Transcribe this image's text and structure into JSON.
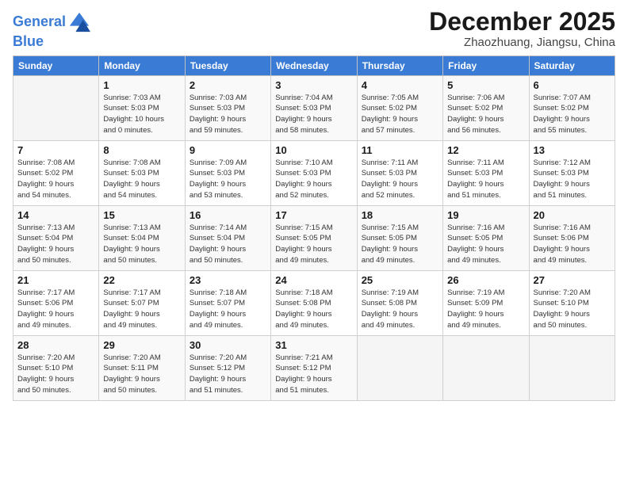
{
  "header": {
    "logo_line1": "General",
    "logo_line2": "Blue",
    "month": "December 2025",
    "location": "Zhaozhuang, Jiangsu, China"
  },
  "weekdays": [
    "Sunday",
    "Monday",
    "Tuesday",
    "Wednesday",
    "Thursday",
    "Friday",
    "Saturday"
  ],
  "weeks": [
    [
      {
        "day": "",
        "info": ""
      },
      {
        "day": "1",
        "info": "Sunrise: 7:03 AM\nSunset: 5:03 PM\nDaylight: 10 hours\nand 0 minutes."
      },
      {
        "day": "2",
        "info": "Sunrise: 7:03 AM\nSunset: 5:03 PM\nDaylight: 9 hours\nand 59 minutes."
      },
      {
        "day": "3",
        "info": "Sunrise: 7:04 AM\nSunset: 5:03 PM\nDaylight: 9 hours\nand 58 minutes."
      },
      {
        "day": "4",
        "info": "Sunrise: 7:05 AM\nSunset: 5:02 PM\nDaylight: 9 hours\nand 57 minutes."
      },
      {
        "day": "5",
        "info": "Sunrise: 7:06 AM\nSunset: 5:02 PM\nDaylight: 9 hours\nand 56 minutes."
      },
      {
        "day": "6",
        "info": "Sunrise: 7:07 AM\nSunset: 5:02 PM\nDaylight: 9 hours\nand 55 minutes."
      }
    ],
    [
      {
        "day": "7",
        "info": "Sunrise: 7:08 AM\nSunset: 5:02 PM\nDaylight: 9 hours\nand 54 minutes."
      },
      {
        "day": "8",
        "info": "Sunrise: 7:08 AM\nSunset: 5:03 PM\nDaylight: 9 hours\nand 54 minutes."
      },
      {
        "day": "9",
        "info": "Sunrise: 7:09 AM\nSunset: 5:03 PM\nDaylight: 9 hours\nand 53 minutes."
      },
      {
        "day": "10",
        "info": "Sunrise: 7:10 AM\nSunset: 5:03 PM\nDaylight: 9 hours\nand 52 minutes."
      },
      {
        "day": "11",
        "info": "Sunrise: 7:11 AM\nSunset: 5:03 PM\nDaylight: 9 hours\nand 52 minutes."
      },
      {
        "day": "12",
        "info": "Sunrise: 7:11 AM\nSunset: 5:03 PM\nDaylight: 9 hours\nand 51 minutes."
      },
      {
        "day": "13",
        "info": "Sunrise: 7:12 AM\nSunset: 5:03 PM\nDaylight: 9 hours\nand 51 minutes."
      }
    ],
    [
      {
        "day": "14",
        "info": "Sunrise: 7:13 AM\nSunset: 5:04 PM\nDaylight: 9 hours\nand 50 minutes."
      },
      {
        "day": "15",
        "info": "Sunrise: 7:13 AM\nSunset: 5:04 PM\nDaylight: 9 hours\nand 50 minutes."
      },
      {
        "day": "16",
        "info": "Sunrise: 7:14 AM\nSunset: 5:04 PM\nDaylight: 9 hours\nand 50 minutes."
      },
      {
        "day": "17",
        "info": "Sunrise: 7:15 AM\nSunset: 5:05 PM\nDaylight: 9 hours\nand 49 minutes."
      },
      {
        "day": "18",
        "info": "Sunrise: 7:15 AM\nSunset: 5:05 PM\nDaylight: 9 hours\nand 49 minutes."
      },
      {
        "day": "19",
        "info": "Sunrise: 7:16 AM\nSunset: 5:05 PM\nDaylight: 9 hours\nand 49 minutes."
      },
      {
        "day": "20",
        "info": "Sunrise: 7:16 AM\nSunset: 5:06 PM\nDaylight: 9 hours\nand 49 minutes."
      }
    ],
    [
      {
        "day": "21",
        "info": "Sunrise: 7:17 AM\nSunset: 5:06 PM\nDaylight: 9 hours\nand 49 minutes."
      },
      {
        "day": "22",
        "info": "Sunrise: 7:17 AM\nSunset: 5:07 PM\nDaylight: 9 hours\nand 49 minutes."
      },
      {
        "day": "23",
        "info": "Sunrise: 7:18 AM\nSunset: 5:07 PM\nDaylight: 9 hours\nand 49 minutes."
      },
      {
        "day": "24",
        "info": "Sunrise: 7:18 AM\nSunset: 5:08 PM\nDaylight: 9 hours\nand 49 minutes."
      },
      {
        "day": "25",
        "info": "Sunrise: 7:19 AM\nSunset: 5:08 PM\nDaylight: 9 hours\nand 49 minutes."
      },
      {
        "day": "26",
        "info": "Sunrise: 7:19 AM\nSunset: 5:09 PM\nDaylight: 9 hours\nand 49 minutes."
      },
      {
        "day": "27",
        "info": "Sunrise: 7:20 AM\nSunset: 5:10 PM\nDaylight: 9 hours\nand 50 minutes."
      }
    ],
    [
      {
        "day": "28",
        "info": "Sunrise: 7:20 AM\nSunset: 5:10 PM\nDaylight: 9 hours\nand 50 minutes."
      },
      {
        "day": "29",
        "info": "Sunrise: 7:20 AM\nSunset: 5:11 PM\nDaylight: 9 hours\nand 50 minutes."
      },
      {
        "day": "30",
        "info": "Sunrise: 7:20 AM\nSunset: 5:12 PM\nDaylight: 9 hours\nand 51 minutes."
      },
      {
        "day": "31",
        "info": "Sunrise: 7:21 AM\nSunset: 5:12 PM\nDaylight: 9 hours\nand 51 minutes."
      },
      {
        "day": "",
        "info": ""
      },
      {
        "day": "",
        "info": ""
      },
      {
        "day": "",
        "info": ""
      }
    ]
  ]
}
